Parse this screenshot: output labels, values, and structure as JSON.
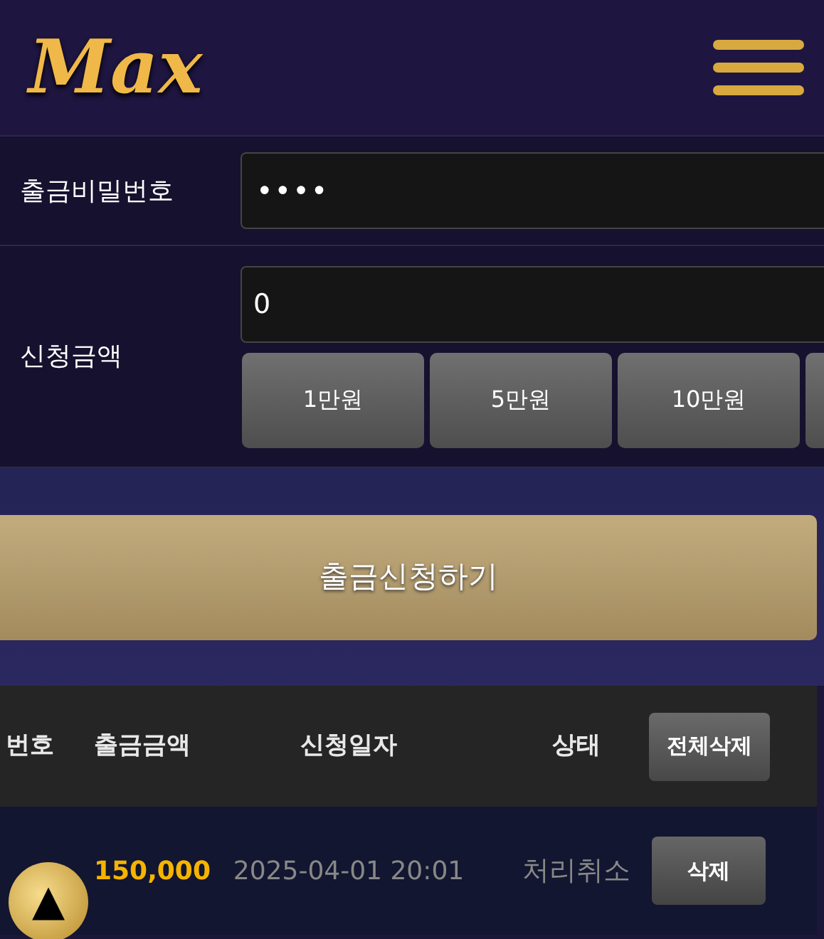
{
  "header": {
    "logo": "Max"
  },
  "form": {
    "password": {
      "label": "출금비밀번호",
      "value": "••••"
    },
    "amount": {
      "label": "신청금액",
      "value": "0"
    },
    "amount_buttons": [
      "1만원",
      "5만원",
      "10만원"
    ]
  },
  "submit_button": "출금신청하기",
  "table": {
    "columns": [
      "번호",
      "출금금액",
      "신청일자",
      "상태"
    ],
    "delete_all_button": "전체삭제",
    "rows": [
      {
        "amount": "150,000",
        "date": "2025-04-01 20:01",
        "status": "처리취소",
        "delete_button": "삭제"
      }
    ]
  },
  "scroll_top_button": "▲"
}
